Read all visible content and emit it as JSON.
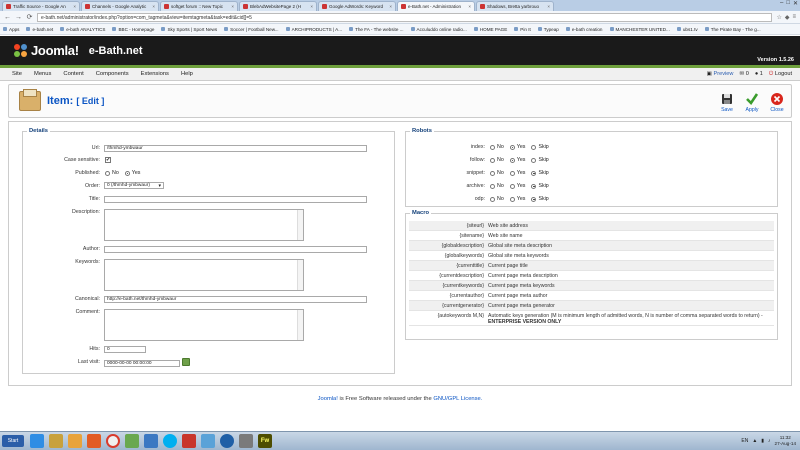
{
  "browser": {
    "tabs": [
      "Traffic Source - Google An",
      "Channels - Google Analytic",
      "softget forum :: New Topic",
      "BlebAdWebsitePage 2 (H",
      "Google AdWords: Keyword",
      "e-Bath.net - Administration",
      "Shadows, Bretta yarbrouo"
    ],
    "active_tab_index": 5,
    "url": "e-bath.net/administrator/index.php?option=com_tagmeta&view=itemtagmeta&task=edit&cid[]=5",
    "bookmarks": [
      "Apps",
      "e-bath.net",
      "e-bath ANALYTICS",
      "BBC - Homepage",
      "Sky Sports | Sport News",
      "Soccer | Football New...",
      "ARCHIPRODUCTS | A...",
      "The FA - The website ...",
      "Acculuddo online radio...",
      "HOME PAGE",
      "Pin It",
      "Typeap",
      "e-bath creation",
      "MANCHESTER UNITED...",
      "ubs1.tv",
      "The Pirate Bay - The g..."
    ]
  },
  "header": {
    "brand": "Joomla!",
    "site_name": "e-Bath.net",
    "version": "Version 1.5.26"
  },
  "menu": {
    "items": [
      "Site",
      "Menus",
      "Content",
      "Components",
      "Extensions",
      "Help"
    ],
    "preview": "Preview",
    "messages": "0",
    "users": "1",
    "logout": "Logout"
  },
  "toolbar": {
    "title": "Item:",
    "subtitle": "[ Edit ]",
    "save": "Save",
    "apply": "Apply",
    "close": "Close"
  },
  "details": {
    "legend": "Details",
    "url_label": "Url:",
    "url_value": "/thmhd-ymbwaur",
    "case_label": "Case sensitive:",
    "case_checked": "✔",
    "published_label": "Published:",
    "no": "No",
    "yes": "Yes",
    "order_label": "Order:",
    "order_value": "0 (/thmhd-ymbwaur)",
    "title_label": "Title:",
    "description_label": "Description:",
    "author_label": "Author:",
    "keywords_label": "Keywords:",
    "canonical_label": "Canonical:",
    "canonical_value": "http://e-bath.net/thmhd-ymbwaur",
    "comment_label": "Comment:",
    "hits_label": "Hits:",
    "hits_value": "0",
    "lastvisit_label": "Last visit:",
    "lastvisit_value": "0000-00-00 00:00:00"
  },
  "robots": {
    "legend": "Robots",
    "options": [
      "No",
      "Yes",
      "Skip"
    ],
    "rows": [
      {
        "label": "index:",
        "selected": "Yes"
      },
      {
        "label": "follow:",
        "selected": "Yes"
      },
      {
        "label": "snippet:",
        "selected": "Skip"
      },
      {
        "label": "archive:",
        "selected": "Skip"
      },
      {
        "label": "odp:",
        "selected": "Skip"
      }
    ]
  },
  "macro": {
    "legend": "Macro",
    "rows": [
      {
        "key": "{siteurl}",
        "value": "Web site address"
      },
      {
        "key": "{sitename}",
        "value": "Web site name"
      },
      {
        "key": "{globaldescription}",
        "value": "Global site meta description"
      },
      {
        "key": "{globalkeywords}",
        "value": "Global site meta keywords"
      },
      {
        "key": "{currenttitle}",
        "value": "Current page title"
      },
      {
        "key": "{currentdescription}",
        "value": "Current page meta description"
      },
      {
        "key": "{currentkeywords}",
        "value": "Current page meta keywords"
      },
      {
        "key": "{currentauthor}",
        "value": "Current page meta author"
      },
      {
        "key": "{currentgenerator}",
        "value": "Current page meta generator"
      },
      {
        "key": "{autokeywords M,N}",
        "value": "Automatic keys generation (M is minimum length of admitted words, N is number of comma separated words to return) - ",
        "value_bold": "ENTERPRISE VERSION ONLY"
      }
    ]
  },
  "footer": {
    "brand": "Joomla!",
    "text": "is Free Software released under the",
    "license": "GNU/GPL License."
  },
  "taskbar": {
    "start": "Start",
    "lang": "EN",
    "time": "11:32",
    "date": "27-Aug-14"
  }
}
